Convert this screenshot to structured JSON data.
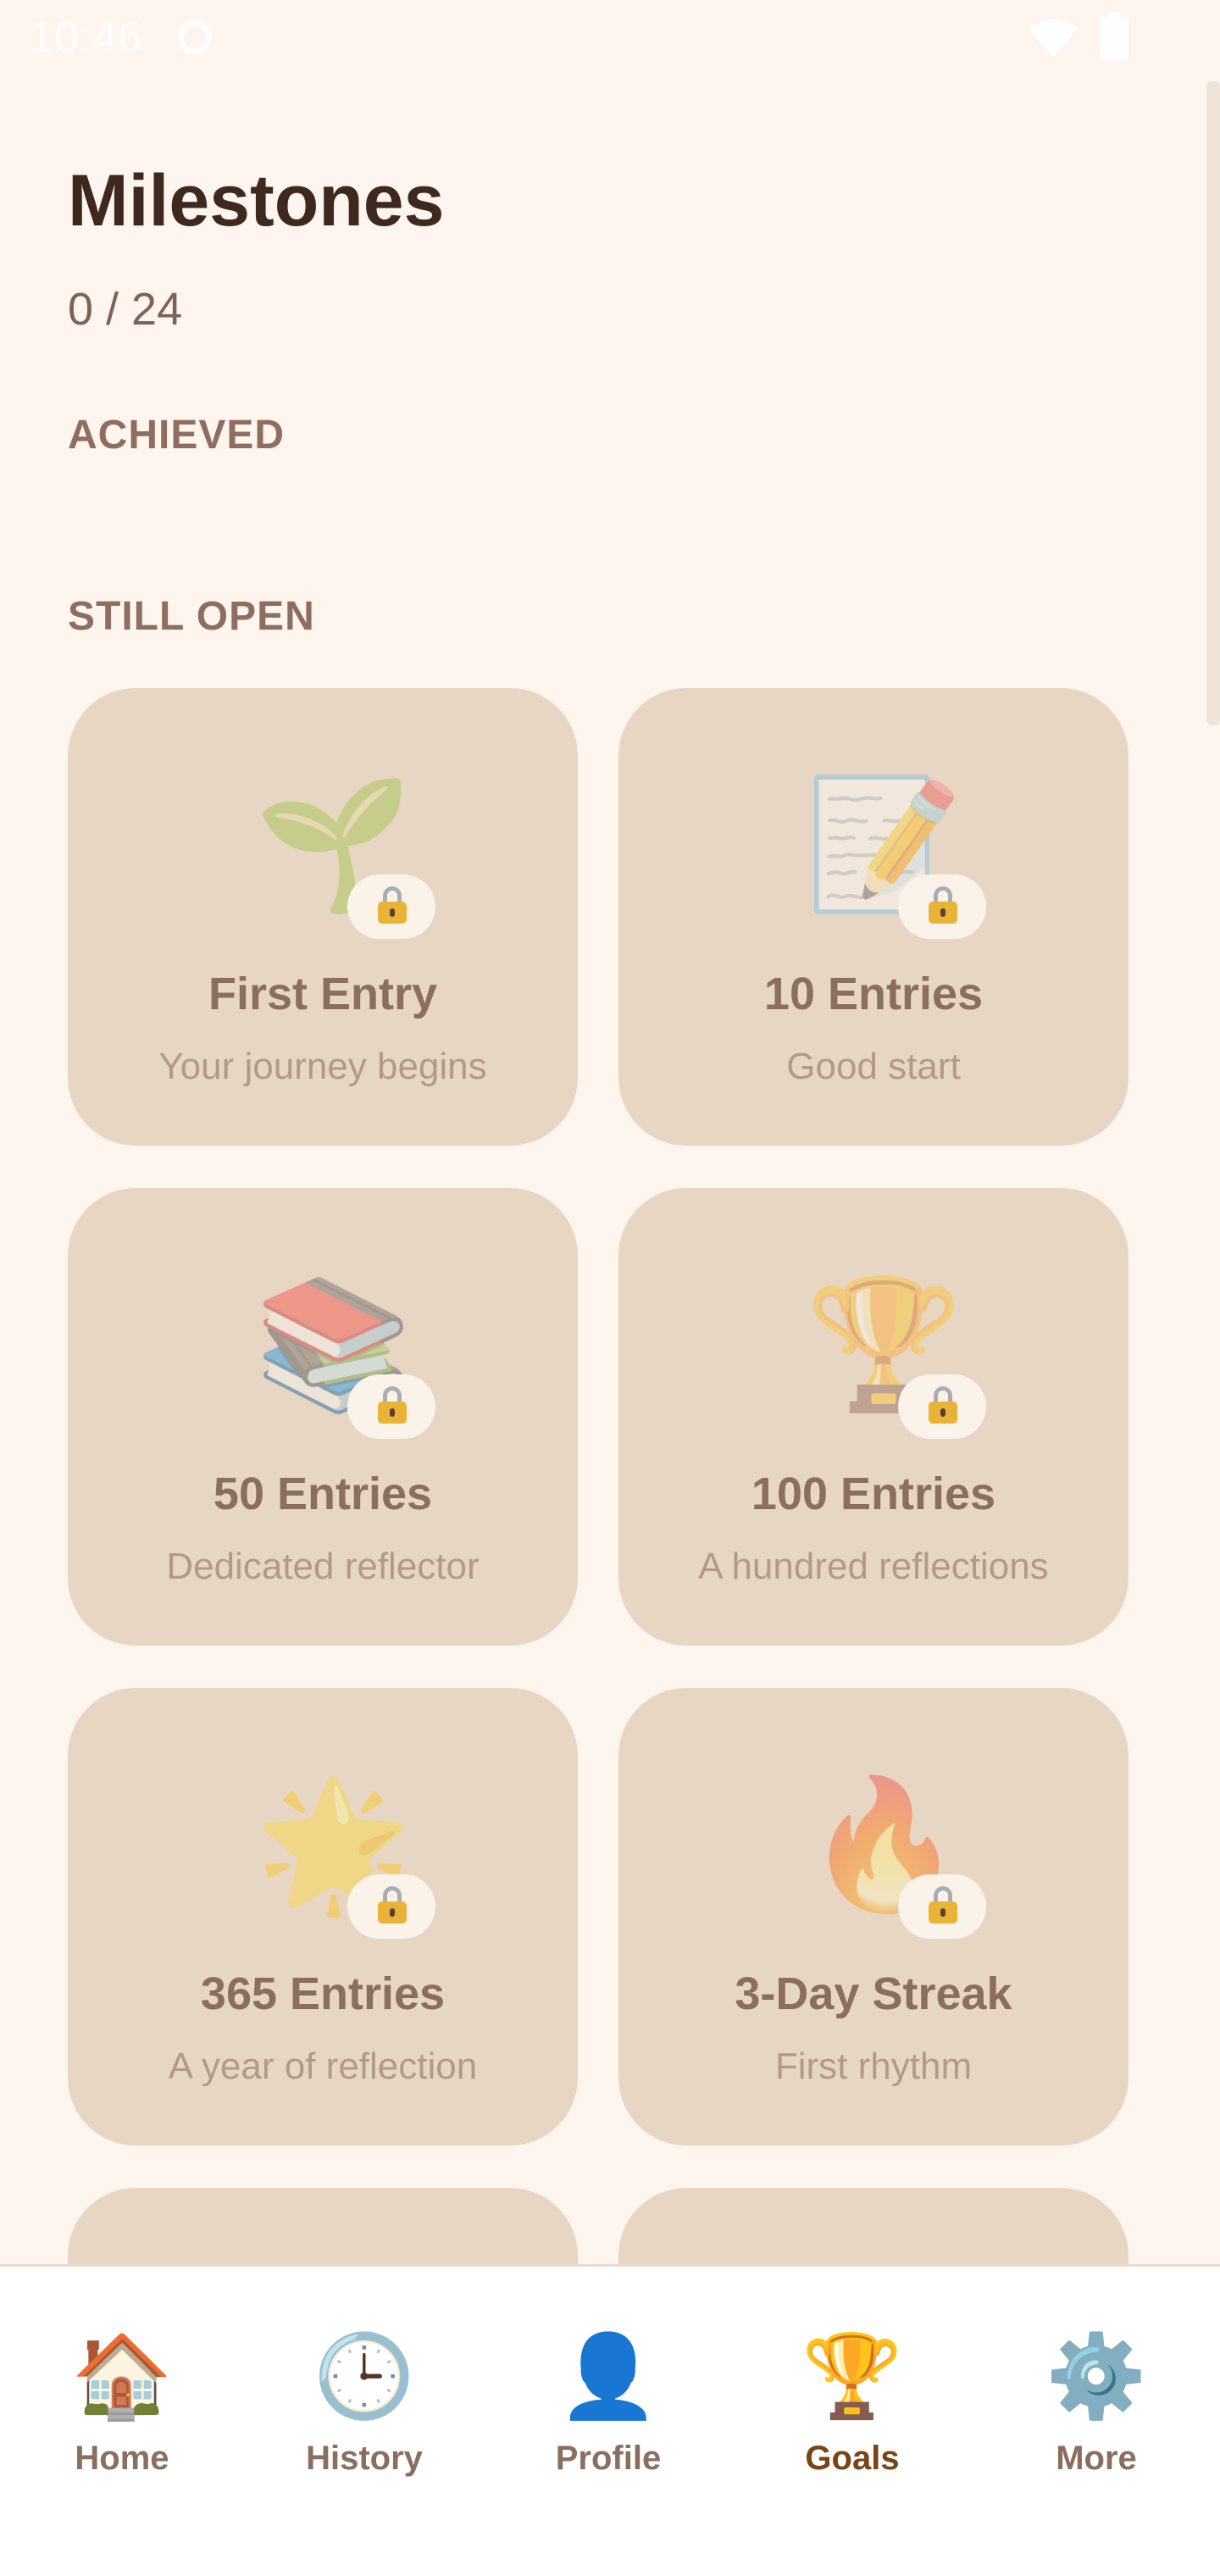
{
  "status_bar": {
    "time": "10:46"
  },
  "header": {
    "title": "Milestones",
    "progress": "0 / 24"
  },
  "sections": {
    "achieved_label": "ACHIEVED",
    "open_label": "STILL OPEN"
  },
  "milestones": [
    {
      "title": "First Entry",
      "subtitle": "Your journey begins",
      "icon": "seedling-icon",
      "emoji": "🌱",
      "locked": true
    },
    {
      "title": "10 Entries",
      "subtitle": "Good start",
      "icon": "memo-icon",
      "emoji": "📝",
      "locked": true
    },
    {
      "title": "50 Entries",
      "subtitle": "Dedicated reflector",
      "icon": "books-icon",
      "emoji": "📚",
      "locked": true
    },
    {
      "title": "100 Entries",
      "subtitle": "A hundred reflections",
      "icon": "trophy-icon",
      "emoji": "🏆",
      "locked": true
    },
    {
      "title": "365 Entries",
      "subtitle": "A year of reflection",
      "icon": "glowing-star-icon",
      "emoji": "🌟",
      "locked": true
    },
    {
      "title": "3-Day Streak",
      "subtitle": "First rhythm",
      "icon": "fire-icon",
      "emoji": "🔥",
      "locked": true
    },
    {
      "title": "",
      "subtitle": "",
      "icon": "",
      "emoji": "",
      "locked": true
    },
    {
      "title": "",
      "subtitle": "",
      "icon": "",
      "emoji": "",
      "locked": true
    }
  ],
  "bottom_nav": {
    "items": [
      {
        "label": "Home",
        "icon": "house-icon",
        "emoji": "🏠"
      },
      {
        "label": "History",
        "icon": "clock-icon",
        "emoji": "🕒"
      },
      {
        "label": "Profile",
        "icon": "person-icon",
        "emoji": "👤"
      },
      {
        "label": "Goals",
        "icon": "trophy-icon",
        "emoji": "🏆",
        "active": true
      },
      {
        "label": "More",
        "icon": "gear-icon",
        "emoji": "⚙️"
      }
    ]
  },
  "colors": {
    "background": "#FEF6EE",
    "card": "#E8D6C4",
    "title_text": "#3E2822",
    "active_nav": "#7A4416"
  }
}
